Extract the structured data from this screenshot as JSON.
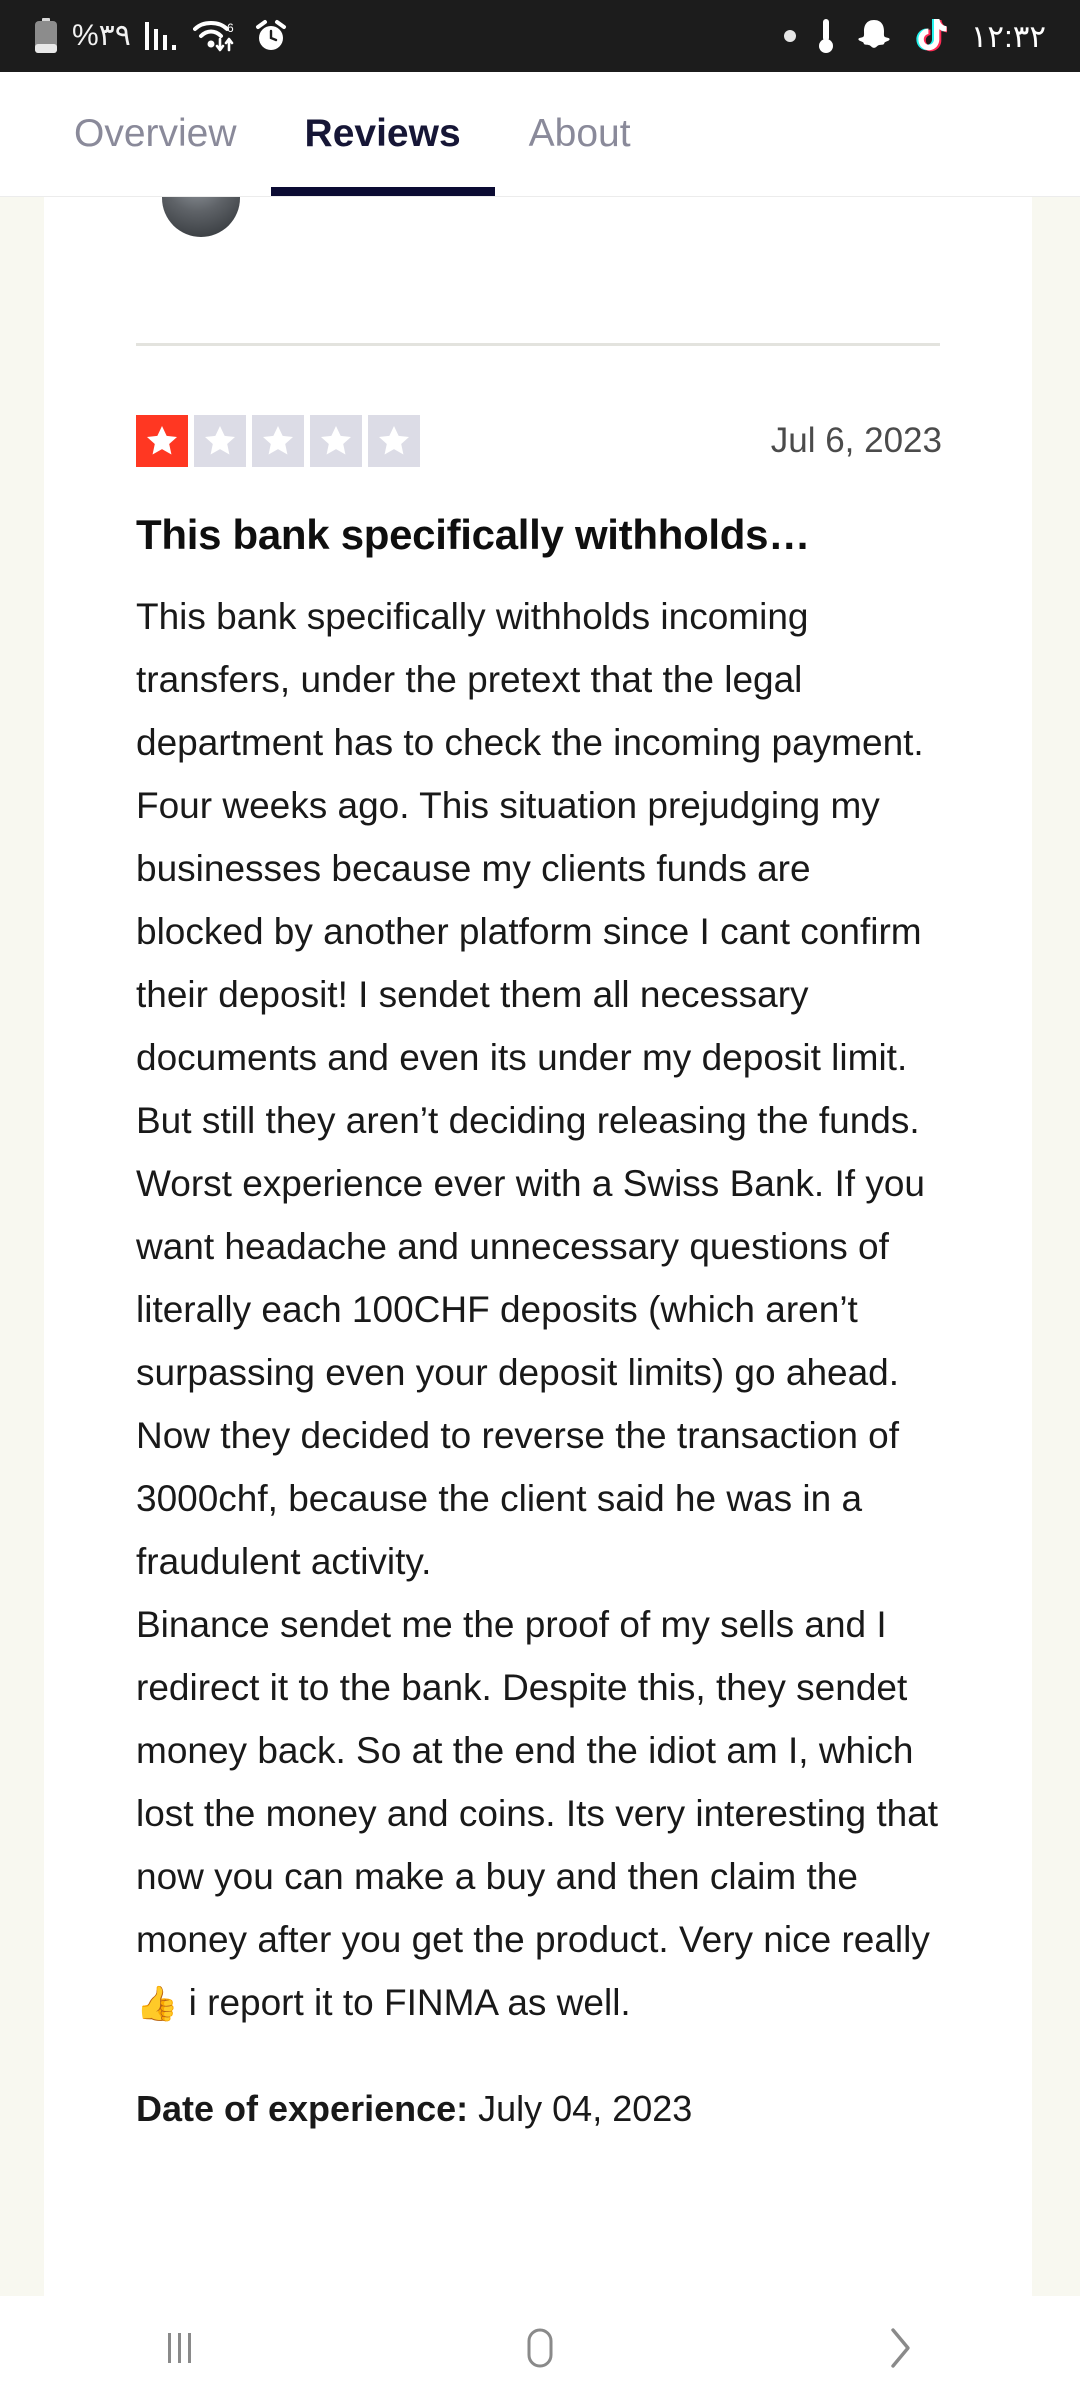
{
  "statusbar": {
    "battery_percent": "%۳۹",
    "time": "۱۲:۳۲",
    "icons": {
      "battery": "battery-icon",
      "signal": "signal-bars-icon",
      "wifi": "wifi-6-data-icon",
      "alarm": "alarm-clock-icon",
      "dot": "notification-dot-icon",
      "thermometer": "thermometer-icon",
      "snapchat": "snapchat-icon",
      "tiktok": "tiktok-icon"
    }
  },
  "tabs": [
    {
      "label": "Overview",
      "active": false
    },
    {
      "label": "Reviews",
      "active": true
    },
    {
      "label": "About",
      "active": false
    }
  ],
  "review": {
    "rating": 1,
    "max_rating": 5,
    "date": "Jul 6, 2023",
    "title": "This bank specifically withholds…",
    "body_before_emoji": "This bank specifically withholds incoming transfers, under the pretext that the legal department has to check the incoming payment.\nFour weeks ago. This situation prejudging my businesses because my clients funds are blocked by another platform since I cant confirm their deposit! I sendet them all necessary documents and even its under my deposit limit. But still they aren’t deciding releasing the funds. Worst experience ever with a Swiss Bank. If you want headache and unnecessary questions of literally each 100CHF deposits (which aren’t surpassing even your deposit limits) go ahead. Now they decided to reverse the transaction of 3000chf, because the client said he was in a fraudulent activity.\nBinance sendet me the proof of my sells and I redirect it to the bank. Despite this, they sendet money back. So at the end the idiot am I, which lost the money and coins. Its very interesting that now you can make a buy and then claim the money after you get the product. Very nice really",
    "emoji": "👍",
    "body_after_emoji": " i report it to FINMA as well.",
    "date_of_experience_label": "Date of experience:",
    "date_of_experience_value": " July 04, 2023"
  },
  "navbar": {
    "recents": "recents-icon",
    "home": "home-icon",
    "back": "back-icon"
  },
  "colors": {
    "star_filled": "#ff3722",
    "star_empty": "#dcdce6",
    "tab_active": "#0b0b33",
    "page_bg": "#f8f8f0",
    "statusbar_bg": "#1c1c1c"
  }
}
